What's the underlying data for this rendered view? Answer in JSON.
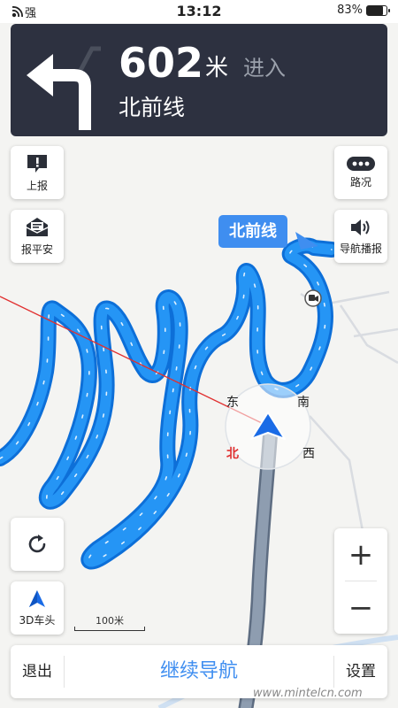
{
  "status_bar": {
    "signal_label": "强",
    "time": "13:12",
    "battery_text": "83%",
    "battery_level": 0.83
  },
  "guidance": {
    "distance": "602",
    "unit": "米",
    "action": "进入",
    "road_name": "北前线",
    "maneuver_icon": "turn-left-arrow-icon"
  },
  "left_buttons": {
    "report_label": "上报",
    "report_icon": "report-exclamation-icon",
    "safe_label": "报平安",
    "safe_icon": "envelope-icon",
    "refresh_icon": "refresh-icon",
    "view_mode_label": "3D车头",
    "view_mode_icon": "compass-arrow-icon"
  },
  "right_buttons": {
    "traffic_label": "路况",
    "traffic_icon": "dots-icon",
    "voice_label": "导航播报",
    "voice_icon": "speaker-icon",
    "zoom_in_label": "+",
    "zoom_out_label": "−"
  },
  "map": {
    "road_label": "北前线",
    "compass": {
      "north": "北",
      "south": "南",
      "east": "东",
      "west": "西"
    },
    "scale_label": "100米",
    "camera_icon": "camera-icon",
    "route_color": "#1f8ef3",
    "traveled_color": "#8e9db0",
    "accent_red": "#e13030"
  },
  "bottom_bar": {
    "exit_label": "退出",
    "continue_label": "继续导航",
    "settings_label": "设置"
  },
  "watermark": "www.mintelcn.com"
}
